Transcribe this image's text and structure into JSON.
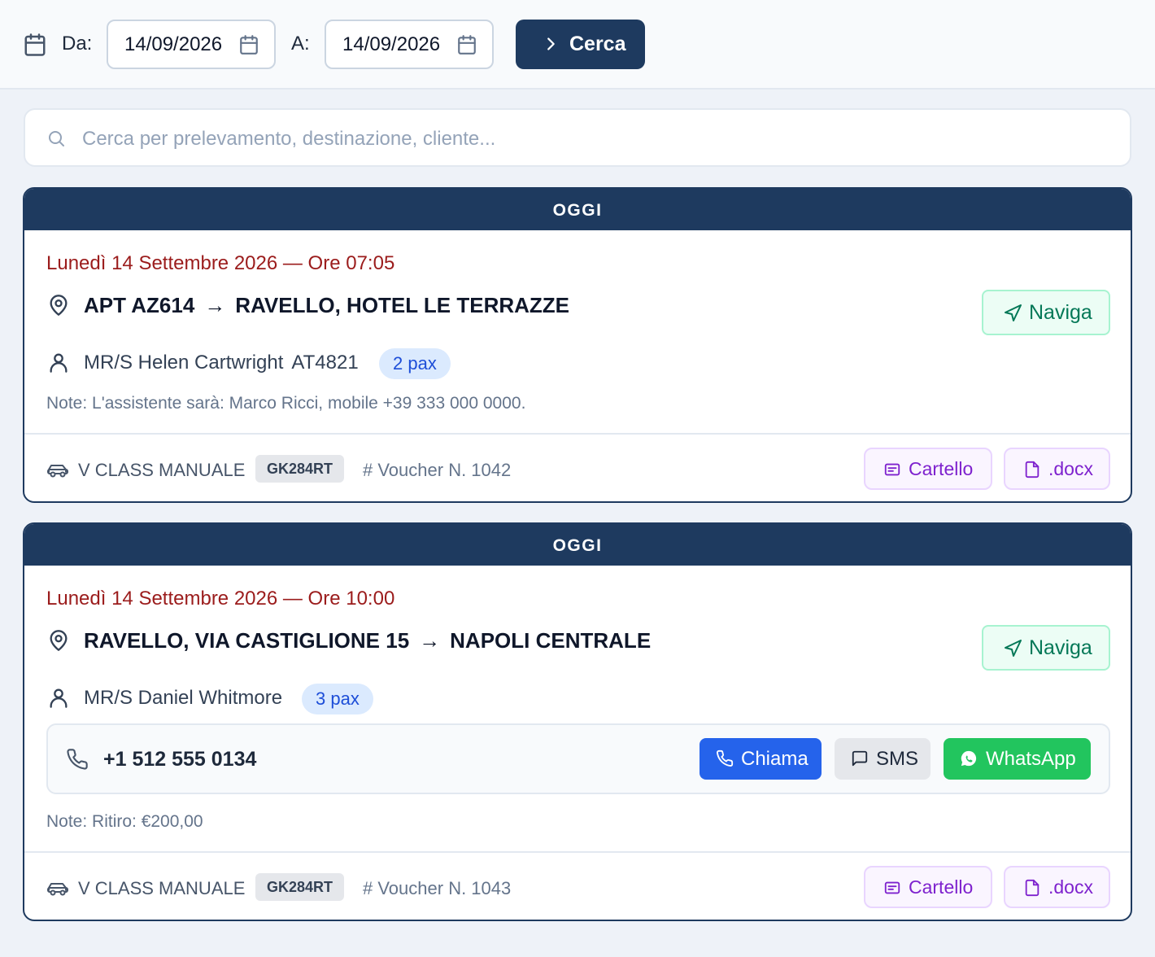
{
  "filters": {
    "from_label": "Da:",
    "from_value": "14/09/2026",
    "to_label": "A:",
    "to_value": "14/09/2026",
    "search_button": "Cerca"
  },
  "search": {
    "placeholder": "Cerca per prelevamento, destinazione, cliente..."
  },
  "colors": {
    "primary": "#1e3a5f",
    "date_red": "#9b1c1c",
    "naviga_green": "#047857",
    "pax_blue": "#1d4ed8",
    "purple": "#7e22ce",
    "call_blue": "#2563eb",
    "whatsapp_green": "#22c55e"
  },
  "bookings": [
    {
      "header": "OGGI",
      "when": "Lunedì 14 Settembre 2026 — Ore 07:05",
      "from": "APT AZ614",
      "arrow": "→",
      "to": "RAVELLO, HOTEL LE TERRAZZE",
      "naviga_label": "Naviga",
      "client": "MR/S Helen Cartwright",
      "flight": "AT4821",
      "pax": "2 pax",
      "note": "Note: L'assistente sarà: Marco Ricci, mobile +39 333 000 0000.",
      "vehicle": "V CLASS MANUALE",
      "plate": "GK284RT",
      "voucher": "# Voucher N. 1042",
      "cartello_label": "Cartello",
      "docx_label": ".docx",
      "icons": [
        "map-pin-icon",
        "navigation-icon",
        "user-icon",
        "car-icon",
        "sign-icon",
        "file-icon"
      ]
    },
    {
      "header": "OGGI",
      "when": "Lunedì 14 Settembre 2026 — Ore 10:00",
      "from": "RAVELLO, VIA CASTIGLIONE 15",
      "arrow": "→",
      "to": "NAPOLI CENTRALE",
      "naviga_label": "Naviga",
      "client": "MR/S Daniel Whitmore",
      "pax": "3 pax",
      "phone": "+1 512 555 0134",
      "call_label": "Chiama",
      "sms_label": "SMS",
      "whatsapp_label": "WhatsApp",
      "note": "Note: Ritiro: €200,00",
      "vehicle": "V CLASS MANUALE",
      "plate": "GK284RT",
      "voucher": "# Voucher N. 1043",
      "cartello_label": "Cartello",
      "docx_label": ".docx",
      "icons": [
        "map-pin-icon",
        "navigation-icon",
        "user-icon",
        "phone-icon",
        "message-icon",
        "whatsapp-icon",
        "car-icon",
        "sign-icon",
        "file-icon"
      ]
    }
  ]
}
